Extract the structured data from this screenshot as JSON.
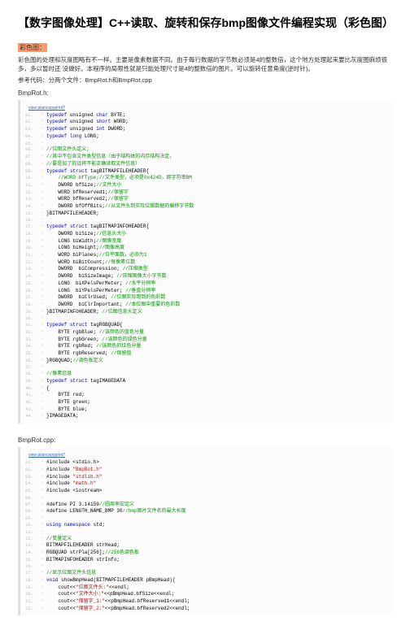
{
  "title": "【数字图像处理】C++读取、旋转和保存bmp图像文件编程实现（彩色图）",
  "section_label": "彩色图：",
  "paragraph1": "彩色图的处理和灰度图略有不一样。主要是像素数据不同。由于每行数据的字节数必须是4的整数倍，这个地方处理起来要比灰度图麻烦很多，多以暂时还 没做好。本程序的局限性就是只能处理尺寸是4的整数倍的图片。可以旋转任意角度(逆时针)。",
  "paragraph2": "参考代码：分两个文件：BmpRot.h和BmpRot.cpp",
  "subhead1": "BmpRot.h:",
  "subhead2": "BmpRot.cpp:",
  "view_plain": "view plaincopyprint?",
  "code1": [
    {
      "n": "01",
      "t": [
        {
          "c": "kw",
          "s": "typedef"
        },
        {
          "c": "pl",
          "s": " unsigned "
        },
        {
          "c": "kw",
          "s": "char"
        },
        {
          "c": "pl",
          "s": " BYTE;"
        }
      ]
    },
    {
      "n": "02",
      "t": [
        {
          "c": "kw",
          "s": "typedef"
        },
        {
          "c": "pl",
          "s": " unsigned "
        },
        {
          "c": "kw",
          "s": "short"
        },
        {
          "c": "pl",
          "s": " WORD;"
        }
      ]
    },
    {
      "n": "03",
      "t": [
        {
          "c": "kw",
          "s": "typedef"
        },
        {
          "c": "pl",
          "s": " unsigned "
        },
        {
          "c": "kw",
          "s": "int"
        },
        {
          "c": "pl",
          "s": " DWORD;"
        }
      ]
    },
    {
      "n": "04",
      "t": [
        {
          "c": "kw",
          "s": "typedef"
        },
        {
          "c": "pl",
          "s": " "
        },
        {
          "c": "kw",
          "s": "long"
        },
        {
          "c": "pl",
          "s": " LONG;"
        }
      ]
    },
    {
      "n": "05",
      "t": [
        {
          "c": "pl",
          "s": ""
        }
      ]
    },
    {
      "n": "06",
      "t": [
        {
          "c": "cm",
          "s": "//位图文件头定义;"
        }
      ]
    },
    {
      "n": "07",
      "t": [
        {
          "c": "cm",
          "s": "//其中不包含文件类型信息（由于结构体的内存结构决定，"
        }
      ]
    },
    {
      "n": "08",
      "t": [
        {
          "c": "cm",
          "s": "//要是加了的话将不能正确读取文件信息）"
        }
      ]
    },
    {
      "n": "09",
      "t": [
        {
          "c": "kw",
          "s": "typedef"
        },
        {
          "c": "pl",
          "s": " "
        },
        {
          "c": "kw",
          "s": "struct"
        },
        {
          "c": "pl",
          "s": " tagBITMAPFILEHEADER{"
        }
      ]
    },
    {
      "n": "10",
      "t": [
        {
          "c": "pl",
          "s": "    "
        },
        {
          "c": "cm",
          "s": "//WORD bfType;//文件类型，必须是0x424D，即字符串BM"
        }
      ]
    },
    {
      "n": "11",
      "t": [
        {
          "c": "pl",
          "s": "    DWORD bfSize;"
        },
        {
          "c": "cm",
          "s": "//文件大小"
        }
      ]
    },
    {
      "n": "12",
      "t": [
        {
          "c": "pl",
          "s": "    WORD bfReserved1;"
        },
        {
          "c": "cm",
          "s": "//保留字"
        }
      ]
    },
    {
      "n": "13",
      "t": [
        {
          "c": "pl",
          "s": "    WORD bfReserved2;"
        },
        {
          "c": "cm",
          "s": "//保留字"
        }
      ]
    },
    {
      "n": "14",
      "t": [
        {
          "c": "pl",
          "s": "    DWORD bfOffBits;"
        },
        {
          "c": "cm",
          "s": "//从文件头到实际位图数据的偏移字节数"
        }
      ]
    },
    {
      "n": "15",
      "t": [
        {
          "c": "pl",
          "s": "}BITMAPFILEHEADER;"
        }
      ]
    },
    {
      "n": "16",
      "t": [
        {
          "c": "pl",
          "s": ""
        }
      ]
    },
    {
      "n": "17",
      "t": [
        {
          "c": "kw",
          "s": "typedef"
        },
        {
          "c": "pl",
          "s": " "
        },
        {
          "c": "kw",
          "s": "struct"
        },
        {
          "c": "pl",
          "s": " tagBITMAPINFOHEADER{"
        }
      ]
    },
    {
      "n": "18",
      "t": [
        {
          "c": "pl",
          "s": "    DWORD biSize;"
        },
        {
          "c": "cm",
          "s": "//信息头大小"
        }
      ]
    },
    {
      "n": "19",
      "t": [
        {
          "c": "pl",
          "s": "    LONG biWidth;"
        },
        {
          "c": "cm",
          "s": "//图像宽度"
        }
      ]
    },
    {
      "n": "20",
      "t": [
        {
          "c": "pl",
          "s": "    LONG biHeight;"
        },
        {
          "c": "cm",
          "s": "//图像高度"
        }
      ]
    },
    {
      "n": "21",
      "t": [
        {
          "c": "pl",
          "s": "    WORD biPlanes;"
        },
        {
          "c": "cm",
          "s": "//位平面数，必须为1"
        }
      ]
    },
    {
      "n": "22",
      "t": [
        {
          "c": "pl",
          "s": "    WORD biBitCount;"
        },
        {
          "c": "cm",
          "s": "//每像素位数"
        }
      ]
    },
    {
      "n": "23",
      "t": [
        {
          "c": "pl",
          "s": "    DWORD  biCompression; "
        },
        {
          "c": "cm",
          "s": "//压缩类型"
        }
      ]
    },
    {
      "n": "24",
      "t": [
        {
          "c": "pl",
          "s": "    DWORD  biSizeImage; "
        },
        {
          "c": "cm",
          "s": "//压缩图像大小字节数"
        }
      ]
    },
    {
      "n": "25",
      "t": [
        {
          "c": "pl",
          "s": "    LONG  biXPelsPerMeter; "
        },
        {
          "c": "cm",
          "s": "//水平分辨率"
        }
      ]
    },
    {
      "n": "26",
      "t": [
        {
          "c": "pl",
          "s": "    LONG  biYPelsPerMeter; "
        },
        {
          "c": "cm",
          "s": "//垂直分辨率"
        }
      ]
    },
    {
      "n": "27",
      "t": [
        {
          "c": "pl",
          "s": "    DWORD  biClrUsed; "
        },
        {
          "c": "cm",
          "s": "//位图实际用到的色彩数"
        }
      ]
    },
    {
      "n": "28",
      "t": [
        {
          "c": "pl",
          "s": "    DWORD  biClrImportant; "
        },
        {
          "c": "cm",
          "s": "//本位图中重要的色彩数"
        }
      ]
    },
    {
      "n": "29",
      "t": [
        {
          "c": "pl",
          "s": "}BITMAPINFOHEADER; "
        },
        {
          "c": "cm",
          "s": "//位图信息头定义"
        }
      ]
    },
    {
      "n": "30",
      "t": [
        {
          "c": "pl",
          "s": ""
        }
      ]
    },
    {
      "n": "31",
      "t": [
        {
          "c": "kw",
          "s": "typedef"
        },
        {
          "c": "pl",
          "s": " "
        },
        {
          "c": "kw",
          "s": "struct"
        },
        {
          "c": "pl",
          "s": " tagRGBQUAD{"
        }
      ]
    },
    {
      "n": "32",
      "t": [
        {
          "c": "pl",
          "s": "    BYTE rgbBlue; "
        },
        {
          "c": "cm",
          "s": "//该颜色的蓝色分量"
        }
      ]
    },
    {
      "n": "33",
      "t": [
        {
          "c": "pl",
          "s": "    BYTE rgbGreen; "
        },
        {
          "c": "cm",
          "s": "//该颜色的绿色分量"
        }
      ]
    },
    {
      "n": "34",
      "t": [
        {
          "c": "pl",
          "s": "    BYTE rgbRed; "
        },
        {
          "c": "cm",
          "s": "//该颜色的红色分量"
        }
      ]
    },
    {
      "n": "35",
      "t": [
        {
          "c": "pl",
          "s": "    BYTE rgbReserved; "
        },
        {
          "c": "cm",
          "s": "//保留值"
        }
      ]
    },
    {
      "n": "36",
      "t": [
        {
          "c": "pl",
          "s": "}RGBQUAD;"
        },
        {
          "c": "cm",
          "s": "//调色板定义"
        }
      ]
    },
    {
      "n": "37",
      "t": [
        {
          "c": "pl",
          "s": ""
        }
      ]
    },
    {
      "n": "38",
      "t": [
        {
          "c": "cm",
          "s": "//像素信息"
        }
      ]
    },
    {
      "n": "39",
      "t": [
        {
          "c": "kw",
          "s": "typedef"
        },
        {
          "c": "pl",
          "s": " "
        },
        {
          "c": "kw",
          "s": "struct"
        },
        {
          "c": "pl",
          "s": " tagIMAGEDATA"
        }
      ]
    },
    {
      "n": "40",
      "t": [
        {
          "c": "pl",
          "s": "{"
        }
      ]
    },
    {
      "n": "41",
      "t": [
        {
          "c": "pl",
          "s": "    BYTE red;"
        }
      ]
    },
    {
      "n": "42",
      "t": [
        {
          "c": "pl",
          "s": "    BYTE green;"
        }
      ]
    },
    {
      "n": "43",
      "t": [
        {
          "c": "pl",
          "s": "    BYTE blue;"
        }
      ]
    },
    {
      "n": "44",
      "t": [
        {
          "c": "pl",
          "s": "}IMAGEDATA;"
        }
      ]
    }
  ],
  "code2": [
    {
      "n": "01",
      "t": [
        {
          "c": "pl",
          "s": "#include <stdio.h>"
        }
      ]
    },
    {
      "n": "02",
      "t": [
        {
          "c": "pl",
          "s": "#include "
        },
        {
          "c": "str",
          "s": "\"BmpRot.h\""
        }
      ]
    },
    {
      "n": "03",
      "t": [
        {
          "c": "pl",
          "s": "#include "
        },
        {
          "c": "str",
          "s": "\"stdlib.h\""
        }
      ]
    },
    {
      "n": "04",
      "t": [
        {
          "c": "pl",
          "s": "#include "
        },
        {
          "c": "str",
          "s": "\"math.h\""
        }
      ]
    },
    {
      "n": "05",
      "t": [
        {
          "c": "pl",
          "s": "#include <iostream>"
        }
      ]
    },
    {
      "n": "06",
      "t": [
        {
          "c": "pl",
          "s": ""
        }
      ]
    },
    {
      "n": "07",
      "t": [
        {
          "c": "pl",
          "s": "#define PI 3.14159"
        },
        {
          "c": "cm",
          "s": "//圆周率宏定义"
        }
      ]
    },
    {
      "n": "08",
      "t": [
        {
          "c": "pl",
          "s": "#define LENGTH_NAME_BMP 30"
        },
        {
          "c": "cm",
          "s": "//bmp图片文件名的最大长度"
        }
      ]
    },
    {
      "n": "09",
      "t": [
        {
          "c": "pl",
          "s": ""
        }
      ]
    },
    {
      "n": "10",
      "t": [
        {
          "c": "kw",
          "s": "using"
        },
        {
          "c": "pl",
          "s": " "
        },
        {
          "c": "kw",
          "s": "namespace"
        },
        {
          "c": "pl",
          "s": " std;"
        }
      ]
    },
    {
      "n": "11",
      "t": [
        {
          "c": "pl",
          "s": ""
        }
      ]
    },
    {
      "n": "12",
      "t": [
        {
          "c": "cm",
          "s": "//变量定义"
        }
      ]
    },
    {
      "n": "13",
      "t": [
        {
          "c": "pl",
          "s": "BITMAPFILEHEADER strHead;"
        }
      ]
    },
    {
      "n": "14",
      "t": [
        {
          "c": "pl",
          "s": "RGBQUAD strPla[256];"
        },
        {
          "c": "cm",
          "s": "//256色调色板"
        }
      ]
    },
    {
      "n": "15",
      "t": [
        {
          "c": "pl",
          "s": "BITMAPINFOHEADER strInfo;"
        }
      ]
    },
    {
      "n": "16",
      "t": [
        {
          "c": "pl",
          "s": ""
        }
      ]
    },
    {
      "n": "17",
      "t": [
        {
          "c": "cm",
          "s": "//显示位图文件头信息"
        }
      ]
    },
    {
      "n": "18",
      "t": [
        {
          "c": "kw",
          "s": "void"
        },
        {
          "c": "pl",
          "s": " showBmpHead(BITMAPFILEHEADER pBmpHead){"
        }
      ]
    },
    {
      "n": "19",
      "t": [
        {
          "c": "pl",
          "s": "    cout<<"
        },
        {
          "c": "str",
          "s": "\"位图文件头:\""
        },
        {
          "c": "pl",
          "s": "<<endl;"
        }
      ]
    },
    {
      "n": "20",
      "t": [
        {
          "c": "pl",
          "s": "    cout<<"
        },
        {
          "c": "str",
          "s": "\"文件大小:\""
        },
        {
          "c": "pl",
          "s": "<<pBmpHead.bfSize<<endl;"
        }
      ]
    },
    {
      "n": "21",
      "t": [
        {
          "c": "pl",
          "s": "    cout<<"
        },
        {
          "c": "str",
          "s": "\"保留字_1:\""
        },
        {
          "c": "pl",
          "s": "<<pBmpHead.bfReserved1<<endl;"
        }
      ]
    },
    {
      "n": "22",
      "t": [
        {
          "c": "pl",
          "s": "    cout<<"
        },
        {
          "c": "str",
          "s": "\"保留字_2:\""
        },
        {
          "c": "pl",
          "s": "<<pBmpHead.bfReserved2<<endl;"
        }
      ]
    }
  ]
}
